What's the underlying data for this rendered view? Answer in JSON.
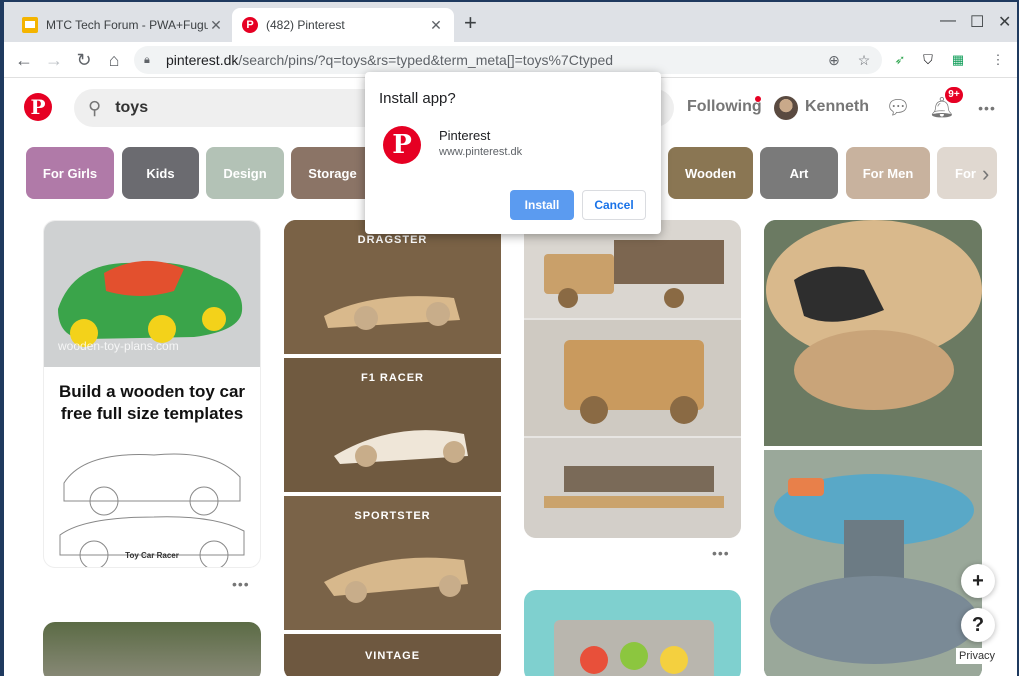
{
  "browser": {
    "tabs": [
      {
        "title": "MTC Tech Forum - PWA+Fugu - G",
        "favicon": "slides-icon",
        "active": false
      },
      {
        "title": "(482) Pinterest",
        "favicon": "pinterest-icon",
        "active": true
      }
    ],
    "new_tab": "+",
    "window_controls": {
      "minimize": "—",
      "maximize": "☐",
      "close": "✕"
    },
    "url_host": "pinterest.dk",
    "url_path": "/search/pins/?q=toys&rs=typed&term_meta[]=toys%7Ctyped"
  },
  "pinterest": {
    "logo": "P",
    "search_value": "toys",
    "following": "Following",
    "username": "Kenneth",
    "notification_badge": "9+",
    "more": "•••"
  },
  "chips": [
    {
      "label": "For Girls",
      "color": "#b07aa8"
    },
    {
      "label": "Kids",
      "color": "#6b6b70"
    },
    {
      "label": "Design",
      "color": "#b3c2b6"
    },
    {
      "label": "Storage",
      "color": "#8b7466"
    },
    {
      "label": "Wooden",
      "color": "#8a7653"
    },
    {
      "label": "Art",
      "color": "#7a7a7a"
    },
    {
      "label": "For Men",
      "color": "#c8b29e"
    },
    {
      "label": "For",
      "color": "#e0d8d0"
    }
  ],
  "pins": {
    "toy_car": {
      "heading": "Build a wooden toy car free full size templates",
      "watermark": "wooden-toy-plans.com",
      "sub": "Toy Car Racer"
    },
    "cars": [
      "DRAGSTER",
      "F1 RACER",
      "SPORTSTER",
      "VINTAGE"
    ],
    "more": "•••"
  },
  "dialog": {
    "title": "Install app?",
    "app_name": "Pinterest",
    "app_url": "www.pinterest.dk",
    "install": "Install",
    "cancel": "Cancel"
  },
  "fabs": {
    "add": "+",
    "help": "?",
    "privacy": "Privacy"
  }
}
